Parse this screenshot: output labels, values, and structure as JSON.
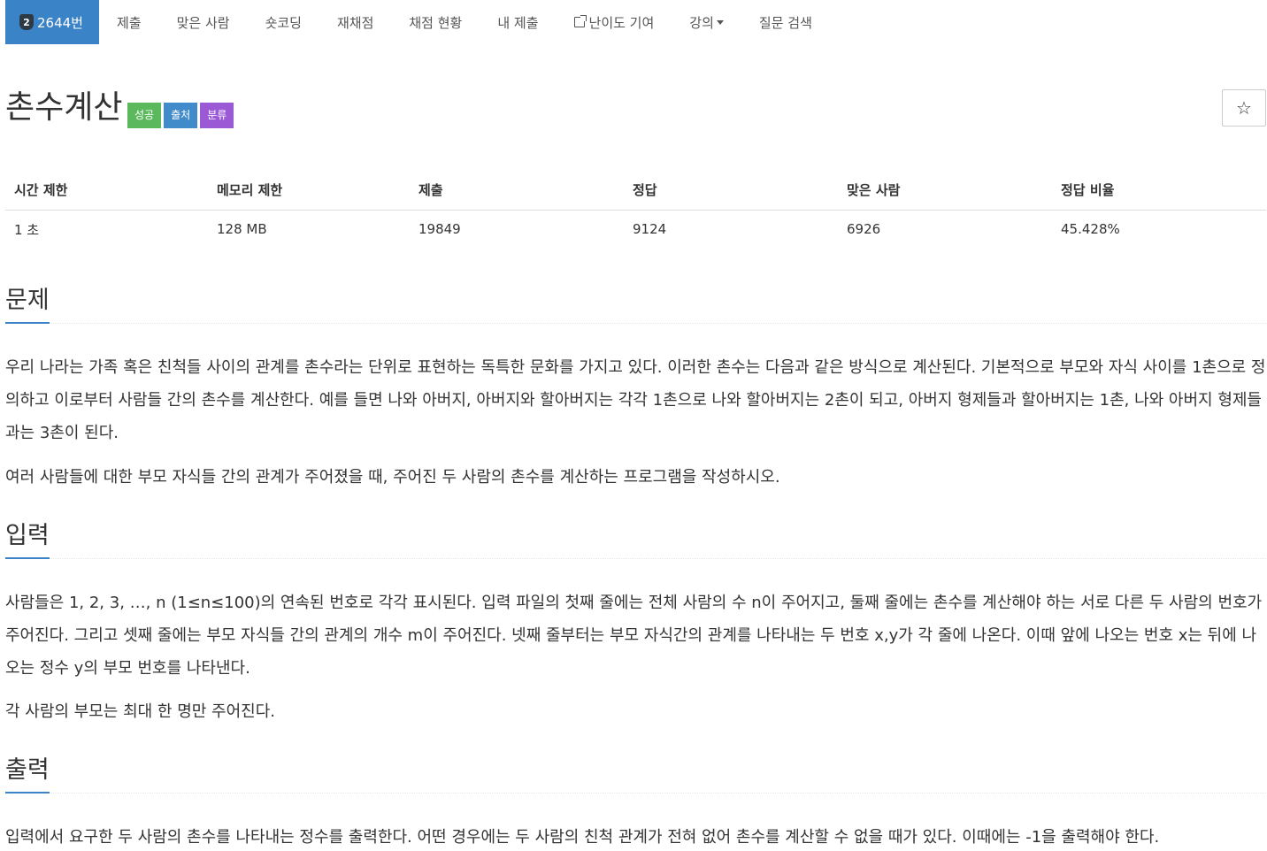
{
  "nav": {
    "problem_tier": "2",
    "problem_id": "2644번",
    "items": [
      "제출",
      "맞은 사람",
      "숏코딩",
      "재채점",
      "채점 현황",
      "내 제출",
      "난이도 기여",
      "강의",
      "질문 검색"
    ]
  },
  "problem": {
    "title": "촌수계산",
    "labels": [
      "성공",
      "출처",
      "분류"
    ]
  },
  "stats": {
    "headers": [
      "시간 제한",
      "메모리 제한",
      "제출",
      "정답",
      "맞은 사람",
      "정답 비율"
    ],
    "values": [
      "1 초",
      "128 MB",
      "19849",
      "9124",
      "6926",
      "45.428%"
    ]
  },
  "sections": {
    "problem": {
      "heading": "문제",
      "paragraphs": [
        "우리 나라는 가족 혹은 친척들 사이의 관계를 촌수라는 단위로 표현하는 독특한 문화를 가지고 있다. 이러한 촌수는 다음과 같은 방식으로 계산된다. 기본적으로 부모와 자식 사이를 1촌으로 정의하고 이로부터 사람들 간의 촌수를 계산한다. 예를 들면 나와 아버지, 아버지와 할아버지는 각각 1촌으로 나와 할아버지는 2촌이 되고, 아버지 형제들과 할아버지는 1촌, 나와 아버지 형제들과는 3촌이 된다.",
        "여러 사람들에 대한 부모 자식들 간의 관계가 주어졌을 때, 주어진 두 사람의 촌수를 계산하는 프로그램을 작성하시오."
      ]
    },
    "input": {
      "heading": "입력",
      "paragraphs": [
        "사람들은 1, 2, 3, …, n (1≤n≤100)의 연속된 번호로 각각 표시된다. 입력 파일의 첫째 줄에는 전체 사람의 수 n이 주어지고, 둘째 줄에는 촌수를 계산해야 하는 서로 다른 두 사람의 번호가 주어진다. 그리고 셋째 줄에는 부모 자식들 간의 관계의 개수 m이 주어진다. 넷째 줄부터는 부모 자식간의 관계를 나타내는 두 번호 x,y가 각 줄에 나온다. 이때 앞에 나오는 번호 x는 뒤에 나오는 정수 y의 부모 번호를 나타낸다.",
        "각 사람의 부모는 최대 한 명만 주어진다."
      ]
    },
    "output": {
      "heading": "출력",
      "paragraphs": [
        "입력에서 요구한 두 사람의 촌수를 나타내는 정수를 출력한다. 어떤 경우에는 두 사람의 친척 관계가 전혀 없어 촌수를 계산할 수 없을 때가 있다. 이때에는 -1을 출력해야 한다."
      ]
    }
  }
}
